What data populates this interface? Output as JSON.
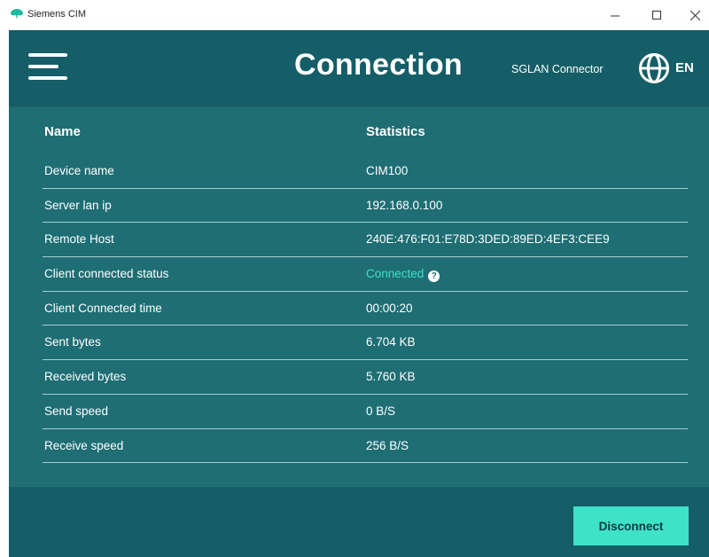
{
  "window": {
    "title": "Siemens CIM",
    "minimize_glyph": "–",
    "maximize_glyph": "☐",
    "close_glyph": "✕"
  },
  "header": {
    "menu_icon": "hamburger-menu-icon",
    "title": "Connection",
    "connector": "SGLAN Connector",
    "globe_icon": "globe-icon",
    "language": "EN"
  },
  "table": {
    "headers": {
      "name": "Name",
      "statistics": "Statistics"
    },
    "rows": [
      {
        "name": "Device name",
        "value": "CIM100"
      },
      {
        "name": "Server lan ip",
        "value": "192.168.0.100"
      },
      {
        "name": "Remote Host",
        "value": "240E:476:F01:E78D:3DED:89ED:4EF3:CEE9"
      },
      {
        "name": "Client connected status",
        "value": "Connected"
      },
      {
        "name": "Client Connected time",
        "value": "00:00:20"
      },
      {
        "name": "Sent bytes",
        "value": "6.704 KB"
      },
      {
        "name": "Received bytes",
        "value": "5.760 KB"
      },
      {
        "name": "Send speed",
        "value": "0 B/S"
      },
      {
        "name": "Receive speed",
        "value": "256 B/S"
      }
    ],
    "help_glyph": "?"
  },
  "footer": {
    "disconnect_label": "Disconnect"
  },
  "colors": {
    "header_bg": "#155e67",
    "content_bg": "#1e6e74",
    "accent": "#3ee2c7"
  }
}
